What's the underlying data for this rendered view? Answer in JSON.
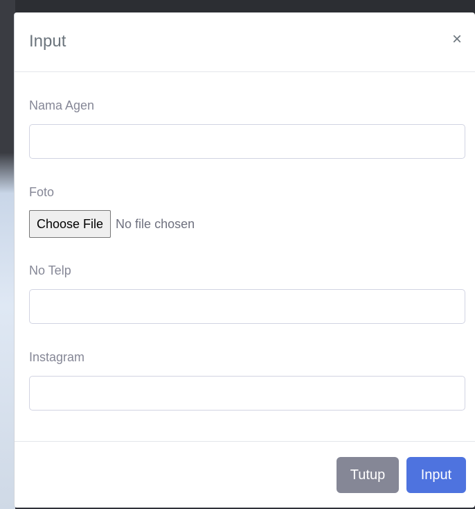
{
  "modal": {
    "title": "Input",
    "close_symbol": "×"
  },
  "form": {
    "nama_agen": {
      "label": "Nama Agen",
      "value": ""
    },
    "foto": {
      "label": "Foto",
      "button_label": "Choose File",
      "status": "No file chosen"
    },
    "no_telp": {
      "label": "No Telp",
      "value": ""
    },
    "instagram": {
      "label": "Instagram",
      "value": ""
    }
  },
  "footer": {
    "close_label": "Tutup",
    "submit_label": "Input"
  },
  "colors": {
    "primary": "#4e73df",
    "secondary": "#858796",
    "text_muted": "#858796"
  },
  "icons": {
    "close": "close-icon"
  }
}
